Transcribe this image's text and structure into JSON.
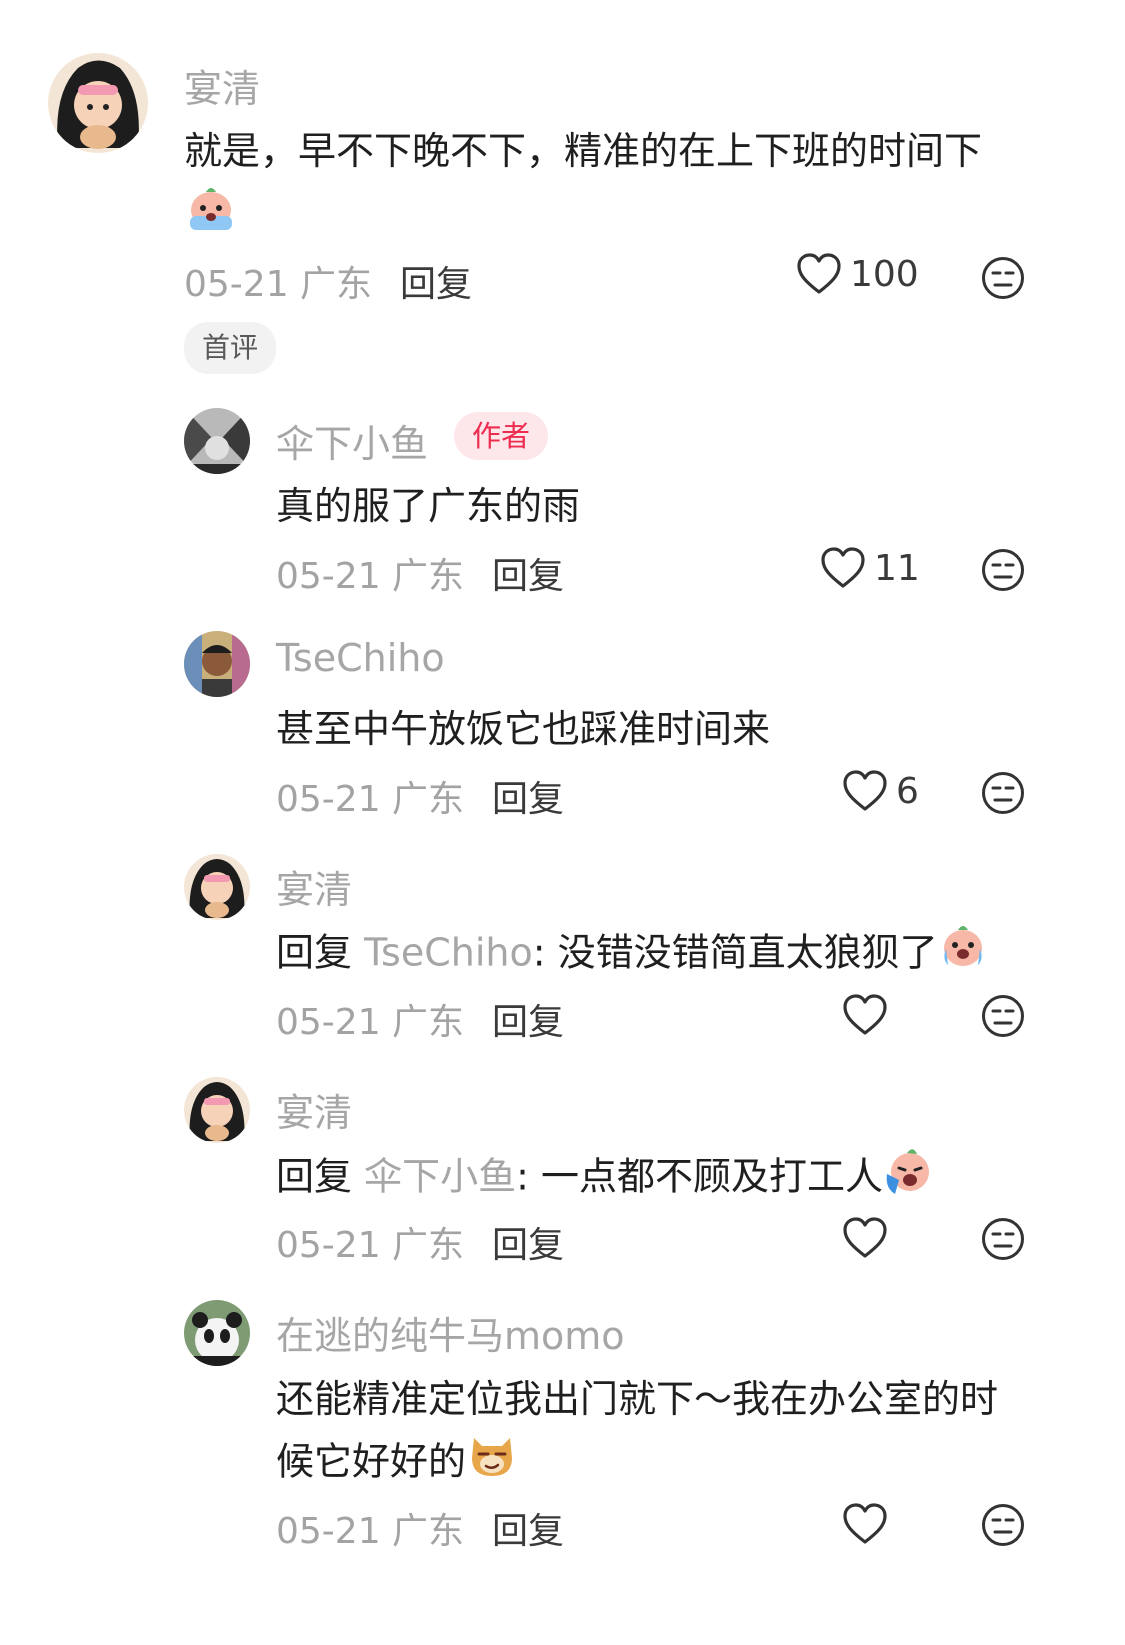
{
  "comments": [
    {
      "name": "宴清",
      "text": "就是，早不下晚不下，精准的在上下班的时间下",
      "date": "05-21 广东",
      "reply_label": "回复",
      "likes": "100",
      "tag": "首评"
    },
    {
      "name": "伞下小鱼",
      "badge": "作者",
      "text": "真的服了广东的雨",
      "date": "05-21 广东",
      "reply_label": "回复",
      "likes": "11"
    },
    {
      "name": "TseChiho",
      "text": "甚至中午放饭它也踩准时间来",
      "date": "05-21 广东",
      "reply_label": "回复",
      "likes": "6"
    },
    {
      "name": "宴清",
      "reply_prefix": "回复",
      "reply_target": "TseChiho",
      "text": ": 没错没错简直太狼狈了",
      "date": "05-21 广东",
      "reply_label": "回复",
      "likes": ""
    },
    {
      "name": "宴清",
      "reply_prefix": "回复",
      "reply_target": "伞下小鱼",
      "text": ": 一点都不顾及打工人",
      "date": "05-21 广东",
      "reply_label": "回复",
      "likes": ""
    },
    {
      "name": "在逃的纯牛马momo",
      "text": "还能精准定位我出门就下～我在办公室的时候它好好的",
      "date": "05-21 广东",
      "reply_label": "回复",
      "likes": ""
    }
  ],
  "colors": {
    "name_gray": "#a6a6a6",
    "author_badge_bg": "#fde7eb",
    "author_badge_text": "#ee2c4f"
  },
  "icons": {
    "like": "heart-outline-icon",
    "dislike": "neutral-face-icon"
  }
}
